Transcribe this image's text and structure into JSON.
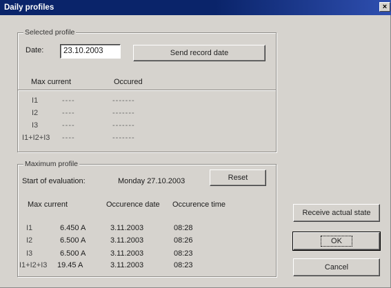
{
  "window": {
    "title": "Daily profiles",
    "close_glyph": "×"
  },
  "selected_profile": {
    "group_title": "Selected profile",
    "date_label": "Date:",
    "date_value": "23.10.2003",
    "send_button": "Send record date",
    "headers": {
      "max_current": "Max current",
      "occured": "Occured"
    },
    "rows": [
      {
        "label": "I1",
        "value": "----",
        "occured": "-------"
      },
      {
        "label": "I2",
        "value": "----",
        "occured": "-------"
      },
      {
        "label": "I3",
        "value": "----",
        "occured": "-------"
      },
      {
        "label": "I1+I2+I3",
        "value": "----",
        "occured": "-------"
      }
    ]
  },
  "maximum_profile": {
    "group_title": "Maximum profile",
    "start_label": "Start of evaluation:",
    "start_value": "Monday 27.10.2003",
    "reset_button": "Reset",
    "headers": {
      "max_current": "Max current",
      "date": "Occurence date",
      "time": "Occurence time"
    },
    "rows": [
      {
        "label": "I1",
        "value": "6.450 A",
        "date": "3.11.2003",
        "time": "08:28"
      },
      {
        "label": "I2",
        "value": "6.500 A",
        "date": "3.11.2003",
        "time": "08:26"
      },
      {
        "label": "I3",
        "value": "6.500 A",
        "date": "3.11.2003",
        "time": "08:23"
      },
      {
        "label": "I1+I2+I3",
        "value": "19.45 A",
        "date": "3.11.2003",
        "time": "08:23"
      }
    ]
  },
  "buttons": {
    "receive": "Receive actual state",
    "ok": "OK",
    "cancel": "Cancel"
  }
}
